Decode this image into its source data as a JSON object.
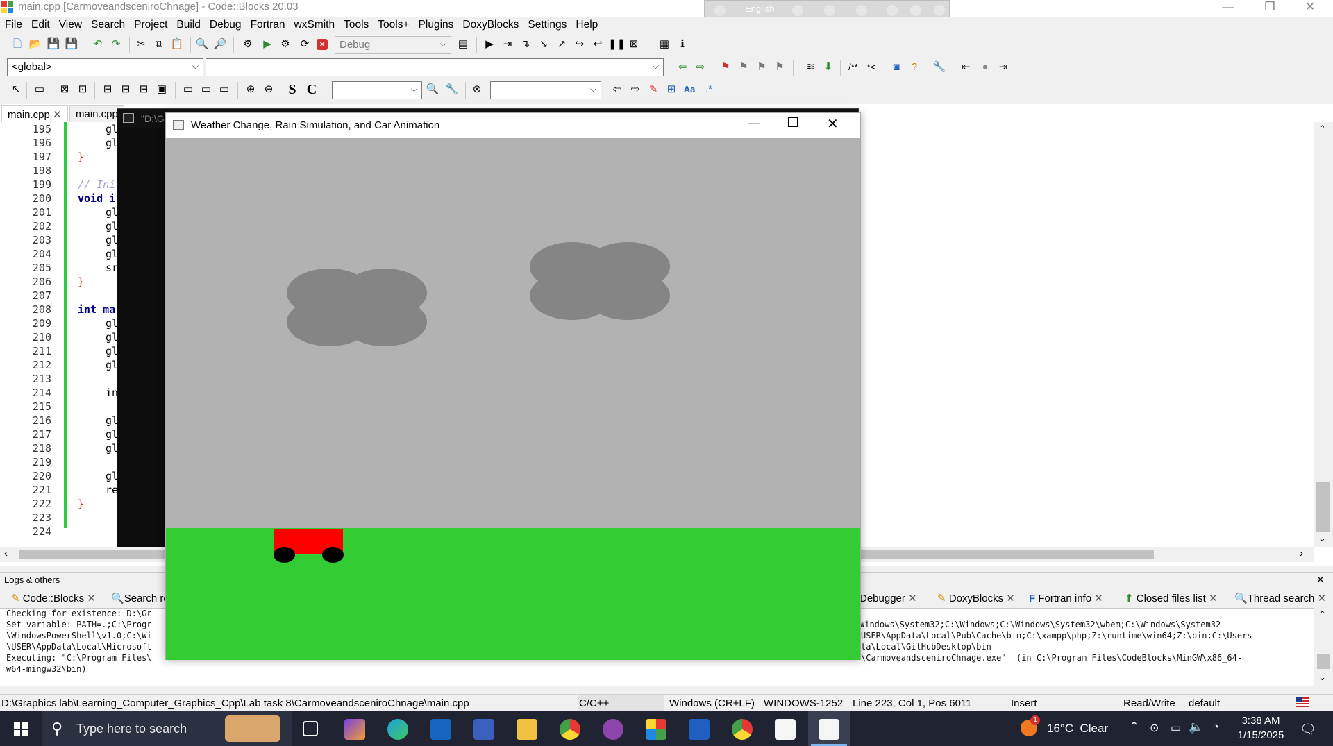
{
  "window": {
    "title": "main.cpp [CarmoveandsceniroChnage] - Code::Blocks 20.03",
    "minimize": "—",
    "restore": "❐",
    "close": "✕"
  },
  "langbar": {
    "language": "English"
  },
  "menu": [
    "File",
    "Edit",
    "View",
    "Search",
    "Project",
    "Build",
    "Debug",
    "Fortran",
    "wxSmith",
    "Tools",
    "Tools+",
    "Plugins",
    "DoxyBlocks",
    "Settings",
    "Help"
  ],
  "toolbar": {
    "build_target": "Debug",
    "scope": "<global>",
    "function": "",
    "search_field": "",
    "regex_label": "Aa",
    "s_label": "S",
    "c_label": "C"
  },
  "editor": {
    "tabs": [
      "main.cpp",
      "main.cpp"
    ],
    "lines": [
      {
        "n": "195",
        "code": "gl"
      },
      {
        "n": "196",
        "code": "gl"
      },
      {
        "n": "197",
        "code": "}"
      },
      {
        "n": "198",
        "code": ""
      },
      {
        "n": "199",
        "code": "// Ini"
      },
      {
        "n": "200",
        "code": "void i"
      },
      {
        "n": "201",
        "code": "gl"
      },
      {
        "n": "202",
        "code": "gl"
      },
      {
        "n": "203",
        "code": "gl"
      },
      {
        "n": "204",
        "code": "gl"
      },
      {
        "n": "205",
        "code": "sr"
      },
      {
        "n": "206",
        "code": "}"
      },
      {
        "n": "207",
        "code": ""
      },
      {
        "n": "208",
        "code": "int ma"
      },
      {
        "n": "209",
        "code": "gl"
      },
      {
        "n": "210",
        "code": "gl"
      },
      {
        "n": "211",
        "code": "gl"
      },
      {
        "n": "212",
        "code": "gl"
      },
      {
        "n": "213",
        "code": ""
      },
      {
        "n": "214",
        "code": "in"
      },
      {
        "n": "215",
        "code": ""
      },
      {
        "n": "216",
        "code": "gl"
      },
      {
        "n": "217",
        "code": "gl"
      },
      {
        "n": "218",
        "code": "gl"
      },
      {
        "n": "219",
        "code": ""
      },
      {
        "n": "220",
        "code": "gl"
      },
      {
        "n": "221",
        "code": "re"
      },
      {
        "n": "222",
        "code": "}"
      },
      {
        "n": "223",
        "code": ""
      },
      {
        "n": "224",
        "code": ""
      }
    ],
    "console_title": "\"D:\\G"
  },
  "gl_window": {
    "title": "Weather Change, Rain Simulation, and Car Animation",
    "sky_color": "#b2b2b2",
    "ground_color": "#33cc33",
    "cloud_color": "#858585",
    "car_color": "#ff0000",
    "wheel_color": "#000000"
  },
  "logs": {
    "title": "Logs & others",
    "tabs": [
      "Code::Blocks",
      "Search re",
      "Debugger",
      "DoxyBlocks",
      "Fortran info",
      "Closed files list",
      "Thread search"
    ],
    "left_lines": [
      "Checking for existence: D:\\Gr",
      "Set variable: PATH=.;C:\\Progr",
      "\\WindowsPowerShell\\v1.0;C:\\Wi",
      "\\USER\\AppData\\Local\\Microsoft",
      "Executing: \"C:\\Program Files\\",
      "w64-mingw32\\bin)"
    ],
    "right_lines": [
      "",
      "Windows\\System32;C:\\Windows;C:\\Windows\\System32\\wbem;C:\\Windows\\System32",
      "USER\\AppData\\Local\\Pub\\Cache\\bin;C:\\xampp\\php;Z:\\runtime\\win64;Z:\\bin;C:\\Users",
      "ta\\Local\\GitHubDesktop\\bin",
      "\\CarmoveandsceniroChnage.exe\"  (in C:\\Program Files\\CodeBlocks\\MinGW\\x86_64-",
      ""
    ]
  },
  "status": {
    "path": "D:\\Graphics lab\\Learning_Computer_Graphics_Cpp\\Lab task 8\\CarmoveandsceniroChnage\\main.cpp",
    "language": "C/C++",
    "eol": "Windows (CR+LF)",
    "encoding": "WINDOWS-1252",
    "position": "Line 223, Col 1, Pos 6011",
    "mode": "Insert",
    "access": "Read/Write",
    "profile": "default"
  },
  "taskbar": {
    "search_placeholder": "Type here to search",
    "weather": "16°C  Clear",
    "time": "3:38 AM",
    "date": "1/15/2025",
    "badge": "1"
  }
}
